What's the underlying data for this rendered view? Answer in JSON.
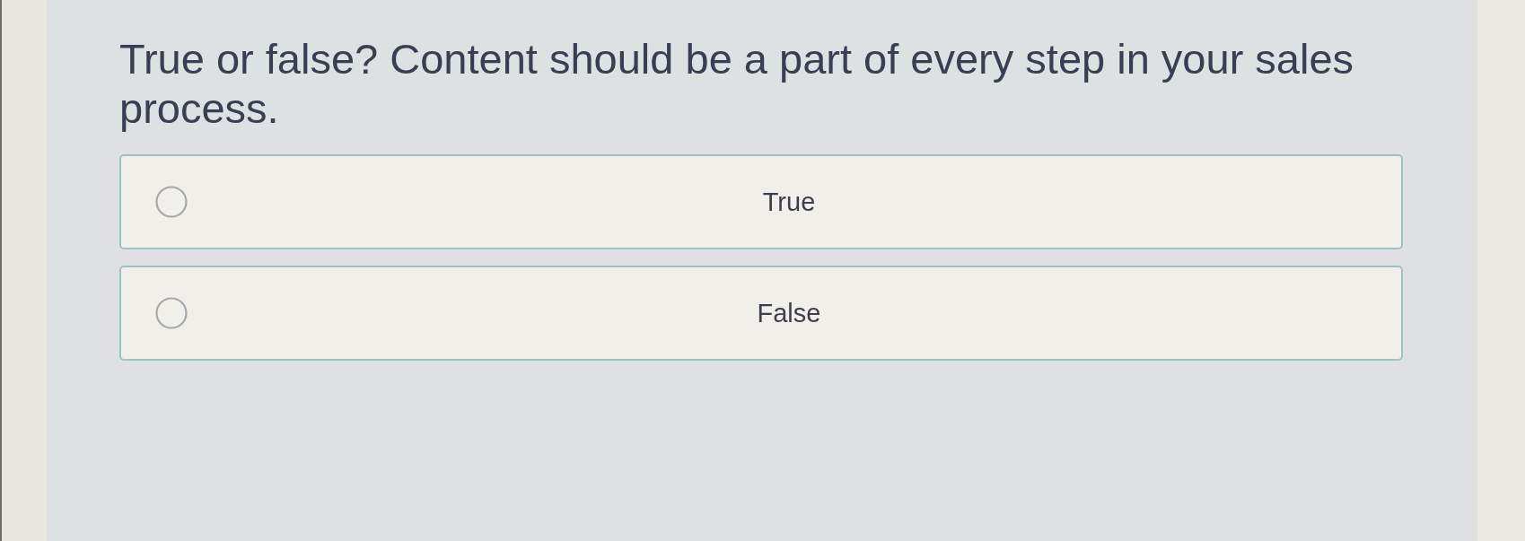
{
  "question": {
    "text": "True or false? Content should be a part of every step in your sales process."
  },
  "options": [
    {
      "label": "True",
      "selected": false
    },
    {
      "label": "False",
      "selected": false
    }
  ]
}
